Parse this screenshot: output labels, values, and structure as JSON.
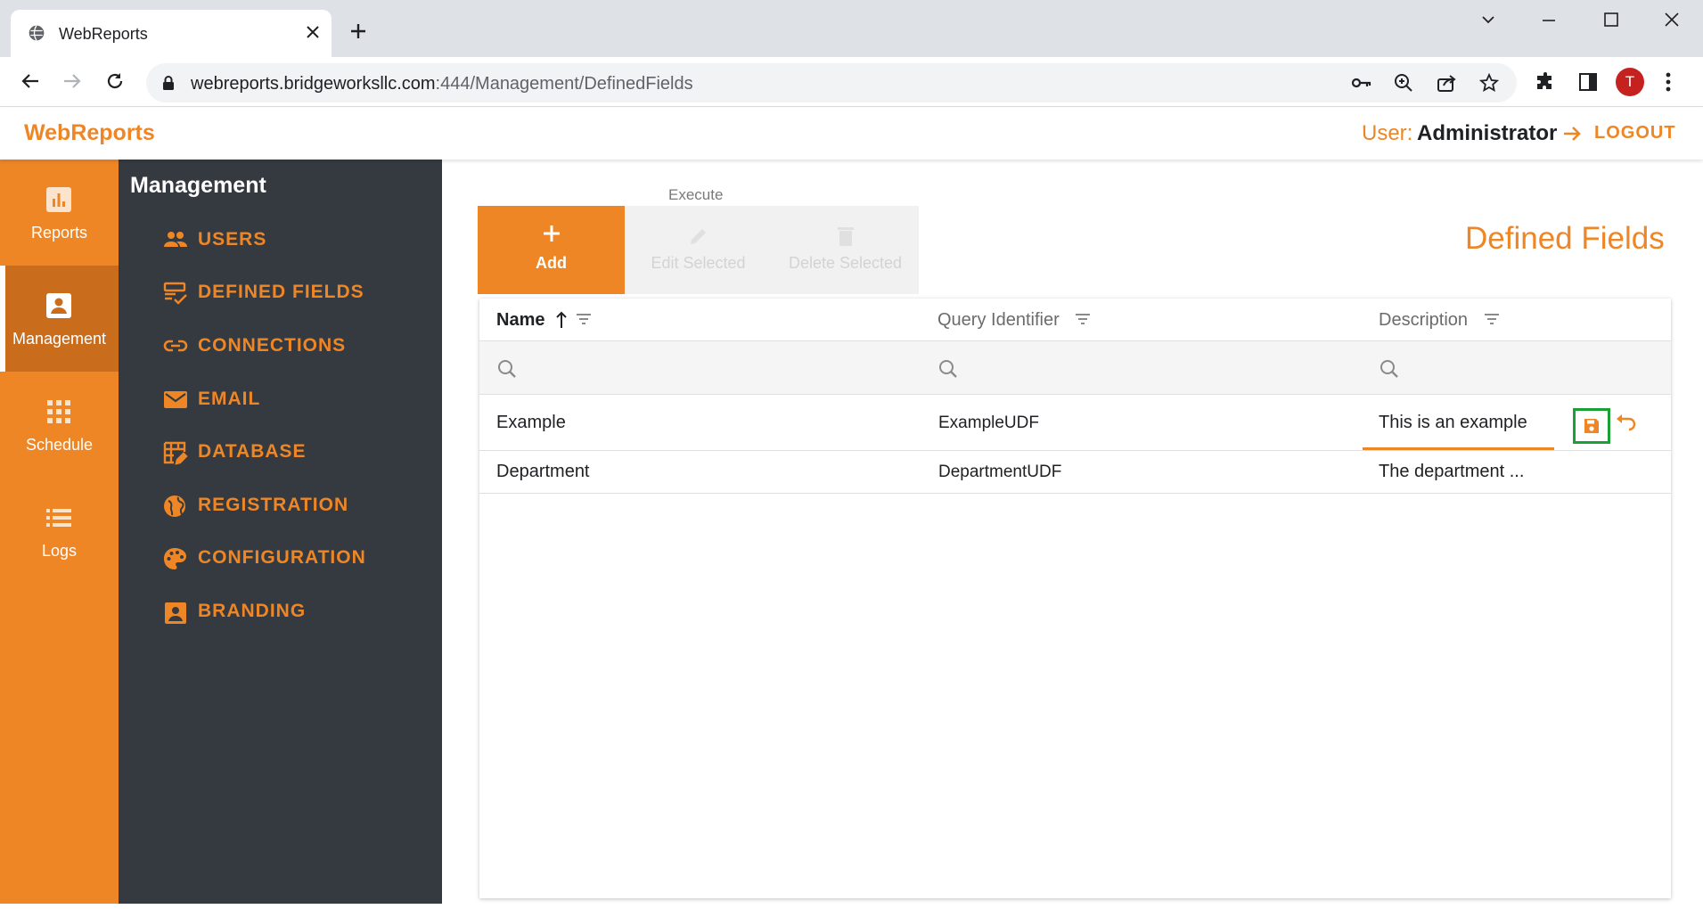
{
  "browser": {
    "tab_title": "WebReports",
    "url_host": "webreports.bridgeworksllc.com",
    "url_path": ":444/Management/DefinedFields",
    "profile_initial": "T"
  },
  "app": {
    "brand": "WebReports",
    "user_label": "User:",
    "user_name": "Administrator",
    "logout_label": "LOGOUT"
  },
  "rail": {
    "items": [
      {
        "label": "Reports",
        "icon": "bar-chart-icon"
      },
      {
        "label": "Management",
        "icon": "account-box-icon"
      },
      {
        "label": "Schedule",
        "icon": "grid-dots-icon"
      },
      {
        "label": "Logs",
        "icon": "list-icon"
      }
    ]
  },
  "subnav": {
    "title": "Management",
    "items": [
      {
        "label": "USERS",
        "icon": "people-icon"
      },
      {
        "label": "DEFINED FIELDS",
        "icon": "form-check-icon"
      },
      {
        "label": "CONNECTIONS",
        "icon": "link-icon"
      },
      {
        "label": "EMAIL",
        "icon": "mail-icon"
      },
      {
        "label": "DATABASE",
        "icon": "table-edit-icon"
      },
      {
        "label": "REGISTRATION",
        "icon": "globe-icon"
      },
      {
        "label": "CONFIGURATION",
        "icon": "palette-icon"
      },
      {
        "label": "BRANDING",
        "icon": "badge-icon"
      }
    ]
  },
  "toolbar": {
    "execute_label": "Execute",
    "add_label": "Add",
    "edit_label": "Edit Selected",
    "delete_label": "Delete Selected"
  },
  "page": {
    "heading": "Defined Fields"
  },
  "grid": {
    "columns": [
      "Name",
      "Query Identifier",
      "Description"
    ],
    "rows": [
      {
        "name": "Example",
        "query_identifier": "ExampleUDF",
        "description": "This is an example",
        "editing": true
      },
      {
        "name": "Department",
        "query_identifier": "DepartmentUDF",
        "description": "The department ...",
        "editing": false
      }
    ]
  },
  "colors": {
    "accent": "#ef8626",
    "accent_dark": "#c96d1c",
    "sidebar": "#343a40",
    "focus": "#1aa034"
  }
}
